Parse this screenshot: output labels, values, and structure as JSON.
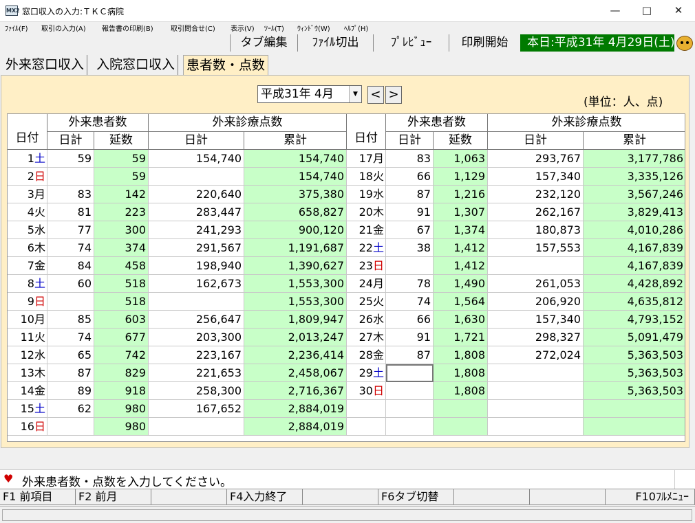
{
  "window": {
    "title": "窓口収入の入力:ＴＫＣ病院",
    "icon_label": "MX2"
  },
  "menu": [
    "ﾌｧｲﾙ(F)",
    "取引の入力(A)",
    "報告書の印刷(B)",
    "取引問合せ(C)",
    "表示(V)",
    "ﾂｰﾙ(T)",
    "ｳｨﾝﾄﾞｳ(W)",
    "ﾍﾙﾌﾟ(H)"
  ],
  "toolbar": {
    "buttons": [
      "タブ編集",
      "ﾌｧｲﾙ切出",
      "ﾌﾟﾚﾋﾞｭｰ",
      "印刷開始"
    ],
    "today": "本日:平成31年 4月29日(土)"
  },
  "tabs": [
    {
      "label": "外来窓口収入",
      "active": false
    },
    {
      "label": "入院窓口収入",
      "active": false
    },
    {
      "label": "患者数・点数",
      "active": true
    }
  ],
  "period": {
    "value": "平成31年  4月",
    "prev": "<",
    "next": ">"
  },
  "unit": "(単位：人、点)",
  "table": {
    "group_headers": {
      "patients": "外来患者数",
      "points": "外来診療点数"
    },
    "col_headers": {
      "day": "日付",
      "daily": "日計",
      "cumulative": "延数",
      "cumsum": "累計"
    },
    "left": [
      {
        "d": "1",
        "w": "土",
        "type": "sat",
        "p": "59",
        "pc": "59",
        "s": "154,740",
        "sc": "154,740"
      },
      {
        "d": "2",
        "w": "日",
        "type": "sun",
        "p": "",
        "pc": "59",
        "s": "",
        "sc": "154,740"
      },
      {
        "d": "3",
        "w": "月",
        "type": "",
        "p": "83",
        "pc": "142",
        "s": "220,640",
        "sc": "375,380"
      },
      {
        "d": "4",
        "w": "火",
        "type": "",
        "p": "81",
        "pc": "223",
        "s": "283,447",
        "sc": "658,827"
      },
      {
        "d": "5",
        "w": "水",
        "type": "",
        "p": "77",
        "pc": "300",
        "s": "241,293",
        "sc": "900,120"
      },
      {
        "d": "6",
        "w": "木",
        "type": "",
        "p": "74",
        "pc": "374",
        "s": "291,567",
        "sc": "1,191,687"
      },
      {
        "d": "7",
        "w": "金",
        "type": "",
        "p": "84",
        "pc": "458",
        "s": "198,940",
        "sc": "1,390,627"
      },
      {
        "d": "8",
        "w": "土",
        "type": "sat",
        "p": "60",
        "pc": "518",
        "s": "162,673",
        "sc": "1,553,300"
      },
      {
        "d": "9",
        "w": "日",
        "type": "sun",
        "p": "",
        "pc": "518",
        "s": "",
        "sc": "1,553,300"
      },
      {
        "d": "10",
        "w": "月",
        "type": "",
        "p": "85",
        "pc": "603",
        "s": "256,647",
        "sc": "1,809,947"
      },
      {
        "d": "11",
        "w": "火",
        "type": "",
        "p": "74",
        "pc": "677",
        "s": "203,300",
        "sc": "2,013,247"
      },
      {
        "d": "12",
        "w": "水",
        "type": "",
        "p": "65",
        "pc": "742",
        "s": "223,167",
        "sc": "2,236,414"
      },
      {
        "d": "13",
        "w": "木",
        "type": "",
        "p": "87",
        "pc": "829",
        "s": "221,653",
        "sc": "2,458,067"
      },
      {
        "d": "14",
        "w": "金",
        "type": "",
        "p": "89",
        "pc": "918",
        "s": "258,300",
        "sc": "2,716,367"
      },
      {
        "d": "15",
        "w": "土",
        "type": "sat",
        "p": "62",
        "pc": "980",
        "s": "167,652",
        "sc": "2,884,019"
      },
      {
        "d": "16",
        "w": "日",
        "type": "sun",
        "p": "",
        "pc": "980",
        "s": "",
        "sc": "2,884,019"
      }
    ],
    "right": [
      {
        "d": "17",
        "w": "月",
        "type": "",
        "p": "83",
        "pc": "1,063",
        "s": "293,767",
        "sc": "3,177,786"
      },
      {
        "d": "18",
        "w": "火",
        "type": "",
        "p": "66",
        "pc": "1,129",
        "s": "157,340",
        "sc": "3,335,126"
      },
      {
        "d": "19",
        "w": "水",
        "type": "",
        "p": "87",
        "pc": "1,216",
        "s": "232,120",
        "sc": "3,567,246"
      },
      {
        "d": "20",
        "w": "木",
        "type": "",
        "p": "91",
        "pc": "1,307",
        "s": "262,167",
        "sc": "3,829,413"
      },
      {
        "d": "21",
        "w": "金",
        "type": "",
        "p": "67",
        "pc": "1,374",
        "s": "180,873",
        "sc": "4,010,286"
      },
      {
        "d": "22",
        "w": "土",
        "type": "sat",
        "p": "38",
        "pc": "1,412",
        "s": "157,553",
        "sc": "4,167,839"
      },
      {
        "d": "23",
        "w": "日",
        "type": "sun",
        "p": "",
        "pc": "1,412",
        "s": "",
        "sc": "4,167,839"
      },
      {
        "d": "24",
        "w": "月",
        "type": "",
        "p": "78",
        "pc": "1,490",
        "s": "261,053",
        "sc": "4,428,892"
      },
      {
        "d": "25",
        "w": "火",
        "type": "",
        "p": "74",
        "pc": "1,564",
        "s": "206,920",
        "sc": "4,635,812"
      },
      {
        "d": "26",
        "w": "水",
        "type": "",
        "p": "66",
        "pc": "1,630",
        "s": "157,340",
        "sc": "4,793,152"
      },
      {
        "d": "27",
        "w": "木",
        "type": "",
        "p": "91",
        "pc": "1,721",
        "s": "298,327",
        "sc": "5,091,479"
      },
      {
        "d": "28",
        "w": "金",
        "type": "",
        "p": "87",
        "pc": "1,808",
        "s": "272,024",
        "sc": "5,363,503"
      },
      {
        "d": "29",
        "w": "土",
        "type": "sat",
        "p": "",
        "pc": "1,808",
        "s": "",
        "sc": "5,363,503"
      },
      {
        "d": "30",
        "w": "日",
        "type": "sun",
        "p": "",
        "pc": "1,808",
        "s": "",
        "sc": "5,363,503"
      }
    ]
  },
  "status": {
    "message": "外来患者数・点数を入力してください。"
  },
  "fkeys": [
    "F1  前項目",
    "F2    前月",
    "",
    "F4入力終了",
    "",
    "F6タブ切替",
    "",
    "",
    "F10ﾌﾙﾒﾆｭｰ"
  ]
}
